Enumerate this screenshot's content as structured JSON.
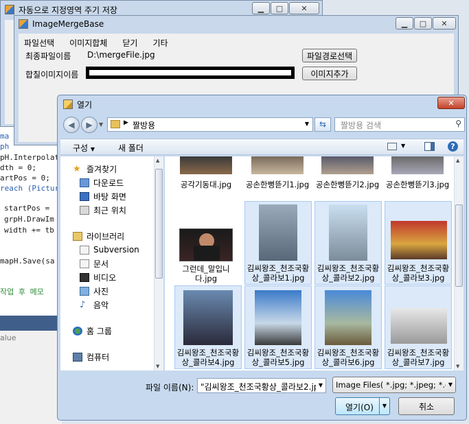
{
  "bg_window": {
    "title": "자동으로 지정영역 주기 저장"
  },
  "code_lines": [
    "ma",
    "ph",
    "pH.Interpolat",
    "dth = 0;",
    "artPos = 0;",
    "reach (Pictur",
    "startPos =",
    "grpH.DrawIm",
    "width += tb",
    "mapH.Save(sa",
    "작업 후 메모"
  ],
  "status_value": "alue",
  "merge_window": {
    "title": "ImageMergeBase",
    "menu": [
      "파일선택",
      "이미지합체",
      "닫기",
      "기타"
    ],
    "final_label": "최종파일이름",
    "final_value": "D:\\mergeFile.jpg",
    "final_button": "파일경로선택",
    "merge_label": "합칠이미지이름",
    "merge_button": "이미지추가"
  },
  "dialog": {
    "title": "열기",
    "address": "짤방용",
    "search_placeholder": "짤방용 검색",
    "toolbar_organize": "구성",
    "toolbar_newfolder": "새 폴더",
    "nav": [
      {
        "label": "즐겨찾기",
        "icon": "star-icon"
      },
      {
        "label": "다운로드",
        "icon": "download-icon"
      },
      {
        "label": "바탕 화면",
        "icon": "desktop-icon"
      },
      {
        "label": "최근 위치",
        "icon": "recent-icon"
      },
      {
        "label": "라이브러리",
        "icon": "library-icon"
      },
      {
        "label": "Subversion",
        "icon": "subversion-icon"
      },
      {
        "label": "문서",
        "icon": "documents-icon"
      },
      {
        "label": "비디오",
        "icon": "video-icon"
      },
      {
        "label": "사진",
        "icon": "pictures-icon"
      },
      {
        "label": "음악",
        "icon": "music-icon"
      },
      {
        "label": "홈 그룹",
        "icon": "homegroup-icon"
      },
      {
        "label": "컴퓨터",
        "icon": "computer-icon"
      }
    ],
    "files": [
      {
        "name": "공각기동대.jpg"
      },
      {
        "name": "공손한뻥뜯기1.jpg"
      },
      {
        "name": "공손한뻥뜯기2.jpg"
      },
      {
        "name": "공손한뻥뜯기3.jpg"
      },
      {
        "name": "그런데_말입니다.jpg"
      },
      {
        "name": "김씨왕조_천조국황상_콜라보1.jpg"
      },
      {
        "name": "김씨왕조_천조국황상_콜라보2.jpg"
      },
      {
        "name": "김씨왕조_천조국황상_콜라보3.jpg"
      },
      {
        "name": "김씨왕조_천조국황상_콜라보4.jpg"
      },
      {
        "name": "김씨왕조_천조국황상_콜라보5.jpg"
      },
      {
        "name": "김씨왕조_천조국황상_콜라보6.jpg"
      },
      {
        "name": "김씨왕조_천조국황상_콜라보7.jpg"
      }
    ],
    "filename_label": "파일 이름(N):",
    "filename_value": "\"김씨왕조_천조국황상_콜라보2.jp",
    "filetype_value": "Image Files( *.jpg; *.jpeg; *.gif;",
    "open_button": "열기(O)",
    "cancel_button": "취소"
  }
}
